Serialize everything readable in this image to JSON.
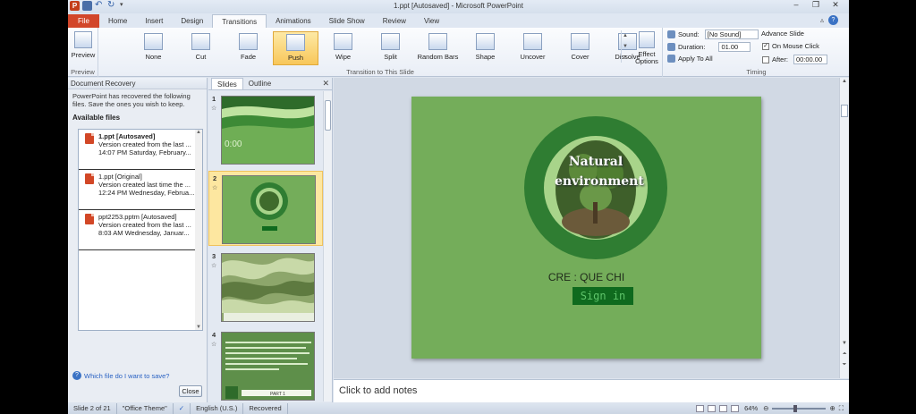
{
  "window": {
    "title": "1.ppt [Autosaved] - Microsoft PowerPoint",
    "app_icon": "P"
  },
  "tabs": [
    "File",
    "Home",
    "Insert",
    "Design",
    "Transitions",
    "Animations",
    "Slide Show",
    "Review",
    "View"
  ],
  "active_tab": "Transitions",
  "ribbon": {
    "preview": {
      "button": "Preview",
      "group": "Preview"
    },
    "transitions": [
      "None",
      "Cut",
      "Fade",
      "Push",
      "Wipe",
      "Split",
      "Random Bars",
      "Shape",
      "Uncover",
      "Cover",
      "Dissolve"
    ],
    "selected_transition": "Push",
    "effect_options": {
      "line1": "Effect",
      "line2": "Options"
    },
    "transition_group": "Transition to This Slide",
    "timing": {
      "sound_label": "Sound:",
      "sound_value": "[No Sound]",
      "duration_label": "Duration:",
      "duration_value": "01.00",
      "apply_all": "Apply To All",
      "advance_label": "Advance Slide",
      "on_mouse_click": "On Mouse Click",
      "after_label": "After:",
      "after_value": "00:00.00",
      "group": "Timing"
    }
  },
  "recovery": {
    "title": "Document Recovery",
    "message": "PowerPoint has recovered the following files. Save the ones you wish to keep.",
    "available": "Available files",
    "files": [
      {
        "name": "1.ppt  [Autosaved]",
        "line1": "Version created from the last ...",
        "line2": "14:07 PM Saturday, February..."
      },
      {
        "name": "1.ppt  [Original]",
        "line1": "Version created last time the ...",
        "line2": "12:24 PM Wednesday, Februa..."
      },
      {
        "name": "ppt2253.pptm  [Autosaved]",
        "line1": "Version created from the last ...",
        "line2": "8:03 AM Wednesday, Januar..."
      }
    ],
    "which_link": "Which file do I want to save?",
    "close": "Close"
  },
  "slides_pane": {
    "tabs": [
      "Slides",
      "Outline"
    ],
    "thumbs": [
      {
        "num": "1",
        "time": "0:00"
      },
      {
        "num": "2"
      },
      {
        "num": "3"
      },
      {
        "num": "4",
        "label": "PART 1"
      }
    ]
  },
  "slide": {
    "title_line1": "Natural",
    "title_line2": "environment",
    "author": "CRE : QUE CHI",
    "button": "Sign in"
  },
  "notes_placeholder": "Click to add notes",
  "status": {
    "slide": "Slide 2 of 21",
    "theme": "\"Office Theme\"",
    "language": "English (U.S.)",
    "recovered": "Recovered",
    "zoom": "64%"
  },
  "colors": {
    "slide_bg": "#74ad5a",
    "ring_dark": "#2f7d32",
    "ring_light": "#a8d48a",
    "button_bg": "#0f6a1e",
    "button_text": "#5fc46a"
  }
}
